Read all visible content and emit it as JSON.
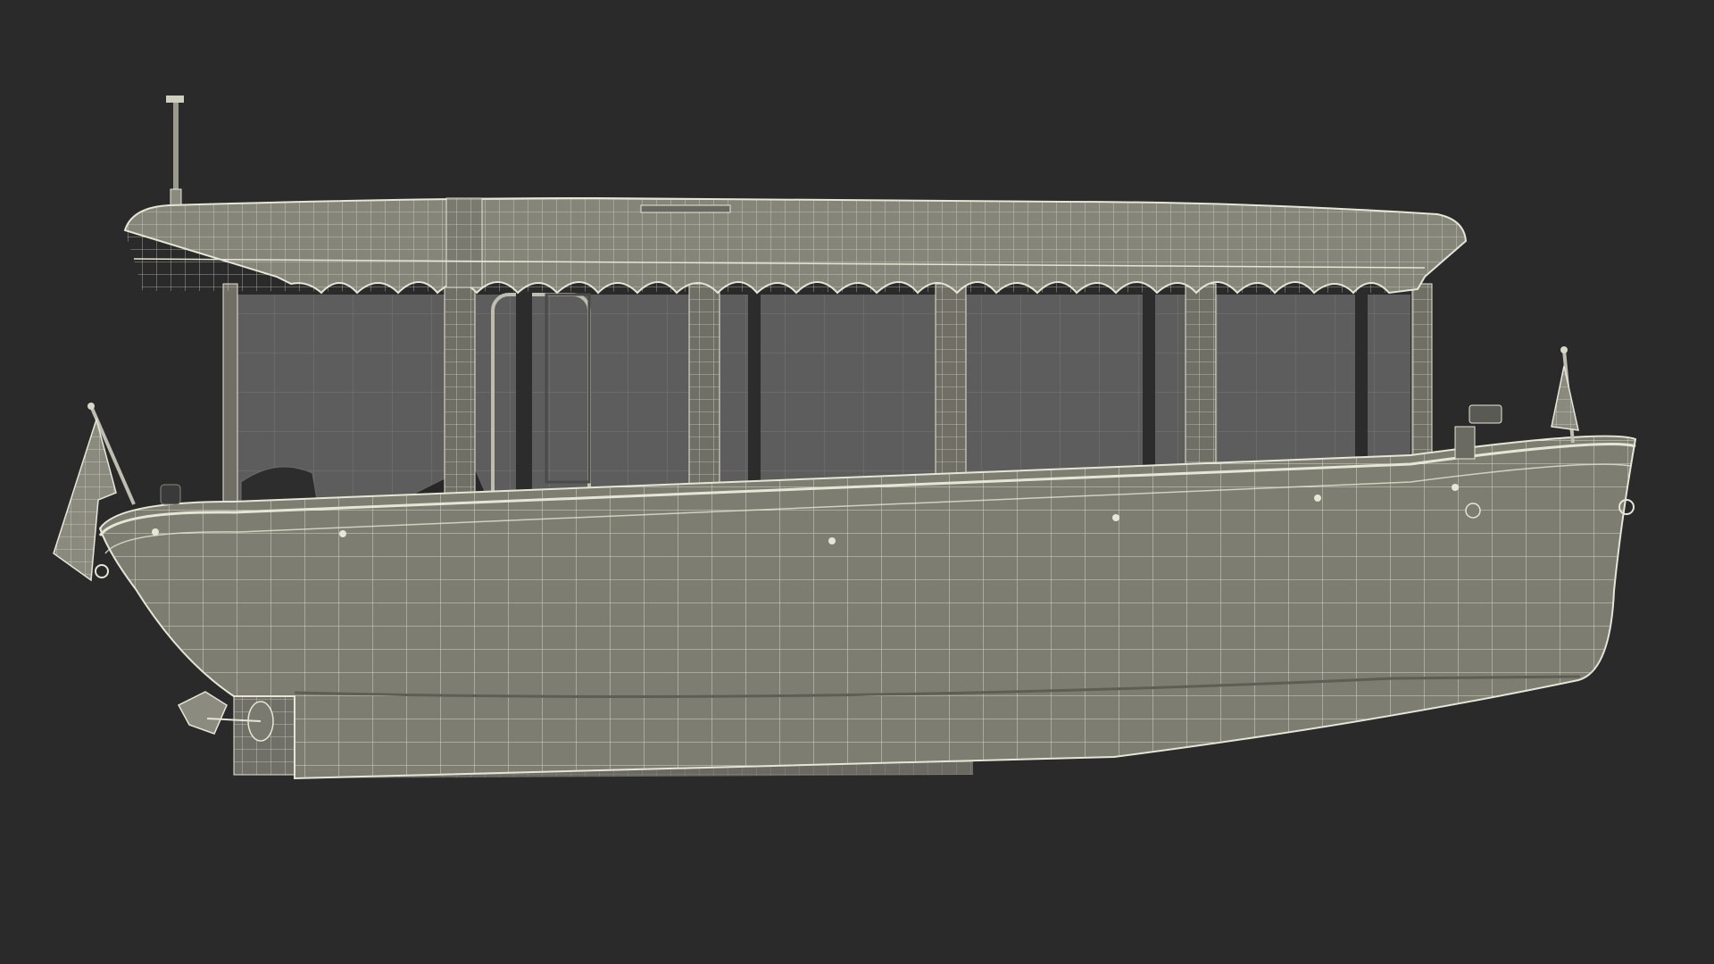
{
  "scene": {
    "background_color": "#2a2a2a",
    "subject": "electric-boat-wireframe",
    "colors": {
      "hull": "#7d7d71",
      "hull_dark": "#5e5e55",
      "wire": "#e6e6d6",
      "canopy": "#85857a",
      "glass": "#8f8f8f",
      "frame": "#6f6f66",
      "interior": "#1f1f1f",
      "keel": "#6a6a62"
    }
  }
}
